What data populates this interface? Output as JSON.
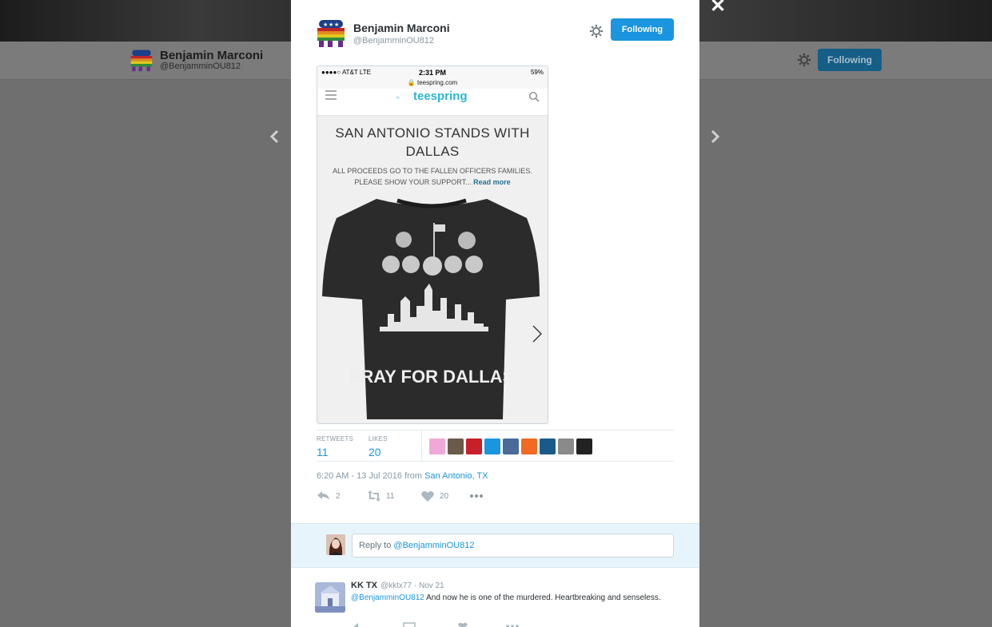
{
  "background_profile": {
    "name": "Benjamin Marconi",
    "handle": "@BenjamminOU812",
    "follow_label": "Following"
  },
  "modal": {
    "author_name": "Benjamin Marconi",
    "author_handle": "@BenjamminOU812",
    "follow_label": "Following",
    "close_icon": "close-icon"
  },
  "screenshot": {
    "carrier": "●●●●○ AT&T  LTE",
    "time": "2:31 PM",
    "battery": "59%",
    "url": "🔒 teespring.com",
    "logo_text": "teespring",
    "title": "SAN ANTONIO STANDS WITH DALLAS",
    "desc": "ALL PROCEEDS GO TO THE FALLEN OFFICERS FAMILIES. PLEASE SHOW YOUR SUPPORT...",
    "read_more": "Read more",
    "shirt_text": "PRAY FOR DALLAS"
  },
  "stats": {
    "retweets_label": "RETWEETS",
    "retweets_value": "11",
    "likes_label": "LIKES",
    "likes_value": "20",
    "liker_colors": [
      "#f0a8d8",
      "#6b5a4a",
      "#c8202a",
      "#1b95e0",
      "#4a6a9a",
      "#f26a21",
      "#1a5a8a",
      "#8a8a8a",
      "#222222"
    ]
  },
  "tweet": {
    "timestamp": "6:20 AM - 13 Jul 2016 from",
    "location": "San Antonio, TX",
    "reply_count": "2",
    "retweet_count": "11",
    "like_count": "20"
  },
  "reply_box": {
    "prefix": "Reply to",
    "mention": "@BenjamminOU812"
  },
  "reply_tweet": {
    "name": "KK TX",
    "meta": "@kktx77 · Nov 21",
    "mention": "@BenjamminOU812",
    "text": " And now he is one of the murdered. Heartbreaking and senseless."
  }
}
